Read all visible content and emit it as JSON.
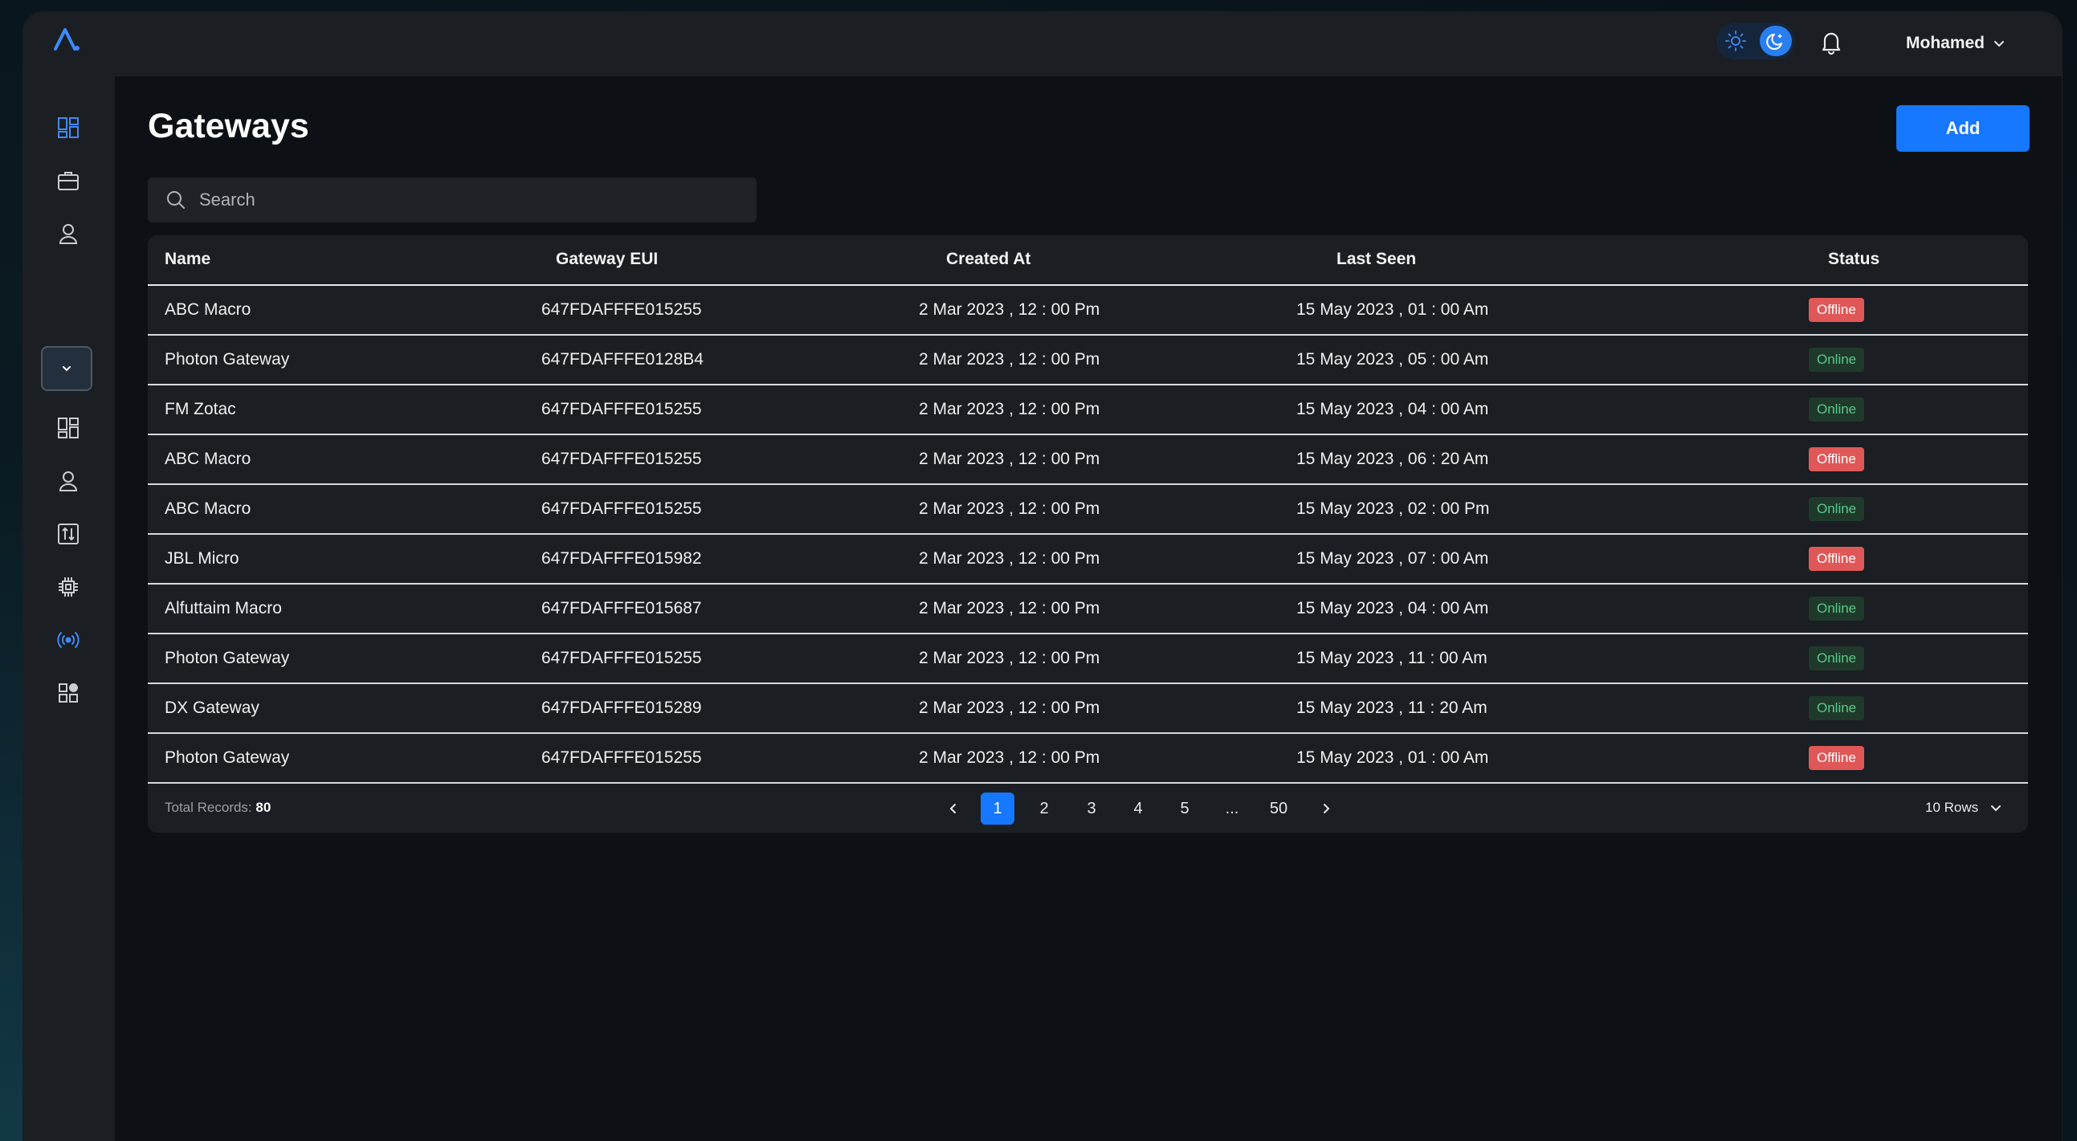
{
  "header": {
    "user_name": "Mohamed"
  },
  "theme": {
    "mode": "dark",
    "accent": "#1677ff"
  },
  "sidebar": {
    "icons": [
      "dashboard-icon",
      "briefcase-icon",
      "user-icon",
      "chevron-down-icon",
      "dashboard-icon",
      "user-icon",
      "sliders-icon",
      "chip-icon",
      "broadcast-icon",
      "apps-icon"
    ],
    "active": "broadcast-icon"
  },
  "page": {
    "title": "Gateways",
    "add_label": "Add",
    "search_placeholder": "Search"
  },
  "table": {
    "columns": [
      "Name",
      "Gateway EUI",
      "Created At",
      "Last Seen",
      "Status"
    ],
    "rows": [
      {
        "name": "ABC Macro",
        "eui": "647FDAFFFE015255",
        "created": "2 Mar 2023 , 12 : 00 Pm",
        "last_seen": "15 May 2023 , 01 : 00 Am",
        "status": "Offline"
      },
      {
        "name": "Photon Gateway",
        "eui": "647FDAFFFE0128B4",
        "created": "2 Mar 2023 , 12 : 00 Pm",
        "last_seen": "15 May 2023 , 05 : 00 Am",
        "status": "Online"
      },
      {
        "name": "FM Zotac",
        "eui": "647FDAFFFE015255",
        "created": "2 Mar 2023 , 12 : 00 Pm",
        "last_seen": "15 May 2023 , 04 : 00 Am",
        "status": "Online"
      },
      {
        "name": "ABC Macro",
        "eui": "647FDAFFFE015255",
        "created": "2 Mar 2023 , 12 : 00 Pm",
        "last_seen": "15 May 2023 , 06 : 20 Am",
        "status": "Offline"
      },
      {
        "name": "ABC Macro",
        "eui": "647FDAFFFE015255",
        "created": "2 Mar 2023 , 12 : 00 Pm",
        "last_seen": "15 May 2023 , 02 : 00 Pm",
        "status": "Online"
      },
      {
        "name": "JBL Micro",
        "eui": "647FDAFFFE015982",
        "created": "2 Mar 2023 , 12 : 00 Pm",
        "last_seen": "15 May 2023 , 07 : 00 Am",
        "status": "Offline"
      },
      {
        "name": "Alfuttaim Macro",
        "eui": "647FDAFFFE015687",
        "created": "2 Mar 2023 , 12 : 00 Pm",
        "last_seen": "15 May 2023 , 04 : 00 Am",
        "status": "Online"
      },
      {
        "name": "Photon Gateway",
        "eui": "647FDAFFFE015255",
        "created": "2 Mar 2023 , 12 : 00 Pm",
        "last_seen": "15 May 2023 , 11 : 00 Am",
        "status": "Online"
      },
      {
        "name": "DX Gateway",
        "eui": "647FDAFFFE015289",
        "created": "2 Mar 2023 , 12 : 00 Pm",
        "last_seen": "15 May 2023 , 11 : 20 Am",
        "status": "Online"
      },
      {
        "name": "Photon Gateway",
        "eui": "647FDAFFFE015255",
        "created": "2 Mar 2023 , 12 : 00 Pm",
        "last_seen": "15 May 2023 , 01 : 00 Am",
        "status": "Offline"
      }
    ]
  },
  "footer": {
    "total_label": "Total Records:",
    "total_value": "80",
    "pages": [
      "1",
      "2",
      "3",
      "4",
      "5",
      "...",
      "50"
    ],
    "current_page": "1",
    "rows_per_page": "10 Rows"
  },
  "colors": {
    "offline": "#e05757",
    "online_text": "#58c98a",
    "online_bg": "#1f3a2b"
  }
}
